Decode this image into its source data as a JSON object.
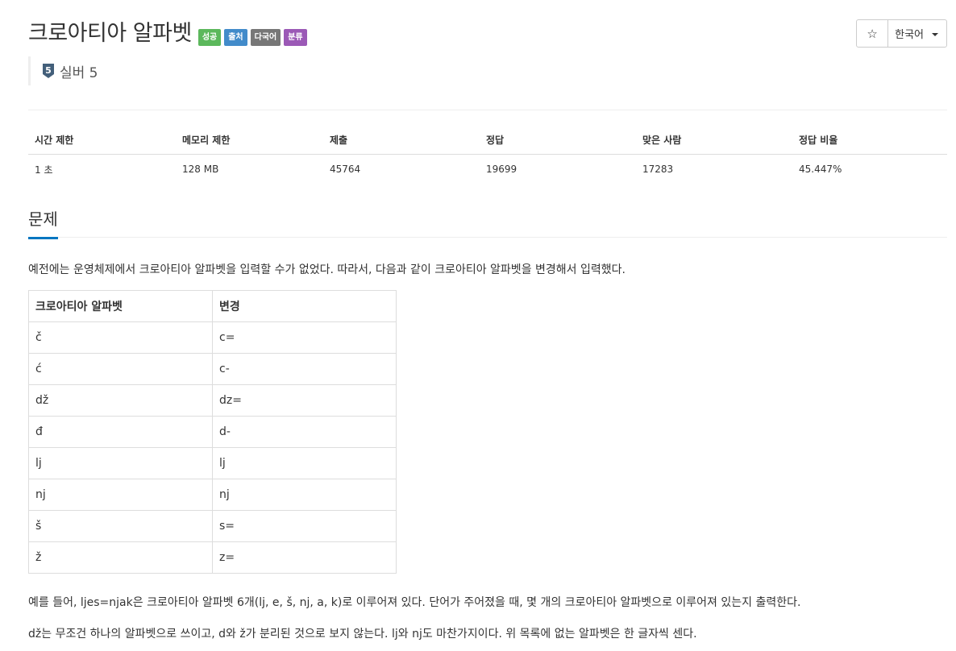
{
  "problem": {
    "title": "크로아티아 알파벳",
    "labels": [
      {
        "text": "성공",
        "color": "#5cb85c"
      },
      {
        "text": "출처",
        "color": "#428bca"
      },
      {
        "text": "다국어",
        "color": "#777777"
      },
      {
        "text": "분류",
        "color": "#9b59b6"
      }
    ],
    "tier": {
      "badge": "5",
      "text": "실버 5",
      "color": "#435f7a"
    }
  },
  "actions": {
    "star": "☆",
    "language": "한국어"
  },
  "info_table": {
    "headers": [
      "시간 제한",
      "메모리 제한",
      "제출",
      "정답",
      "맞은 사람",
      "정답 비율"
    ],
    "values": [
      "1 초",
      "128 MB",
      "45764",
      "19699",
      "17283",
      "45.447%"
    ]
  },
  "section": {
    "title": "문제",
    "accent": "#0076c0"
  },
  "description": {
    "intro": "예전에는 운영체제에서 크로아티아 알파벳을 입력할 수가 없었다. 따라서, 다음과 같이 크로아티아 알파벳을 변경해서 입력했다.",
    "para2": "예를 들어, ljes=njak은 크로아티아 알파벳 6개(lj, e, š, nj, a, k)로 이루어져 있다. 단어가 주어졌을 때, 몇 개의 크로아티아 알파벳으로 이루어져 있는지 출력한다.",
    "para3": "dž는 무조건 하나의 알파벳으로 쓰이고, d와 ž가 분리된 것으로 보지 않는다. lj와 nj도 마찬가지이다. 위 목록에 없는 알파벳은 한 글자씩 센다."
  },
  "alphabet_table": {
    "headers": [
      "크로아티아 알파벳",
      "변경"
    ],
    "rows": [
      [
        "č",
        "c="
      ],
      [
        "ć",
        "c-"
      ],
      [
        "dž",
        "dz="
      ],
      [
        "đ",
        "d-"
      ],
      [
        "lj",
        "lj"
      ],
      [
        "nj",
        "nj"
      ],
      [
        "š",
        "s="
      ],
      [
        "ž",
        "z="
      ]
    ]
  }
}
